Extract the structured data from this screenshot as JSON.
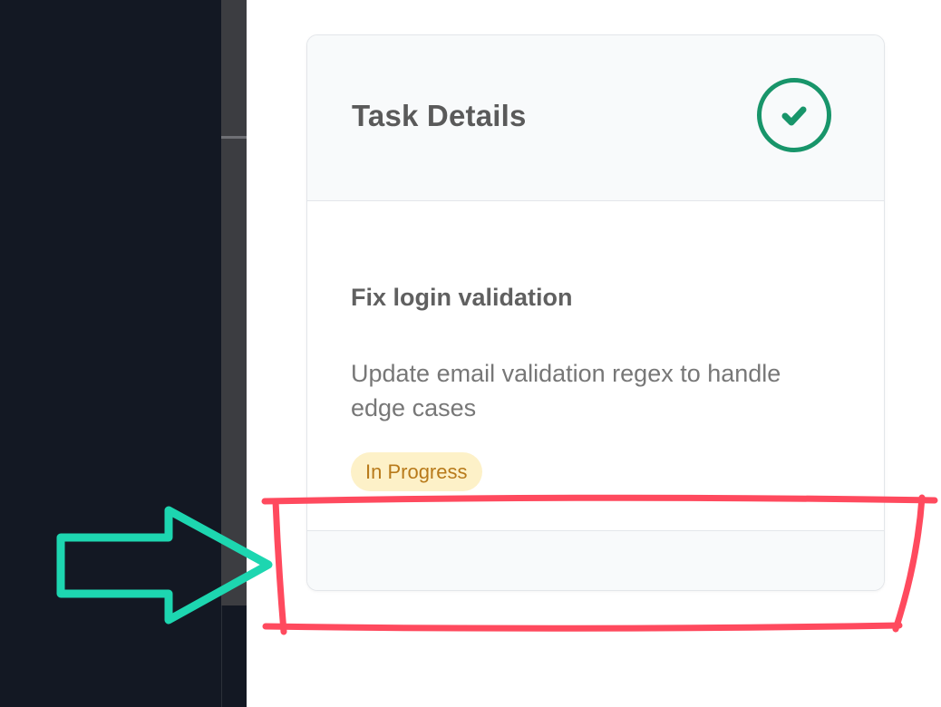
{
  "card": {
    "title": "Task Details",
    "status_icon": "check-circle-icon",
    "task_title": "Fix login validation",
    "task_description": "Update email validation regex to handle edge cases",
    "status_badge": "In Progress"
  },
  "annotations": {
    "arrow_icon": "right-arrow-icon",
    "highlight": "highlight-rectangle"
  },
  "colors": {
    "success": "#18956a",
    "badge_text": "#b87a1a",
    "badge_bg": "#fdf1c8",
    "highlight": "#ff4a5e",
    "arrow": "#1dd6b0",
    "sidebar_bg": "#131823"
  }
}
